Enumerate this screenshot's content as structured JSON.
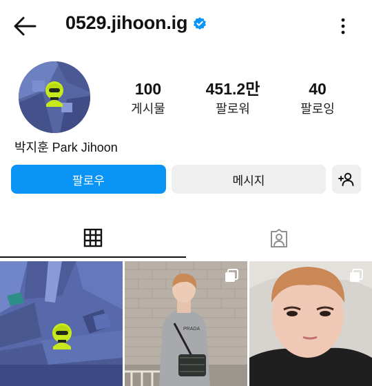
{
  "header": {
    "username": "0529.jihoon.ig",
    "back_icon": "arrow-left-icon",
    "verified_icon": "verified-badge-icon",
    "more_icon": "more-vertical-icon"
  },
  "profile": {
    "display_name": "박지훈 Park Jihoon",
    "stats": [
      {
        "value": "100",
        "label": "게시물"
      },
      {
        "value": "451.2만",
        "label": "팔로워"
      },
      {
        "value": "40",
        "label": "팔로잉"
      }
    ]
  },
  "actions": {
    "follow_label": "팔로우",
    "message_label": "메시지",
    "suggest_icon": "add-person-icon"
  },
  "tabs": {
    "posts_icon": "grid-icon",
    "tagged_icon": "tagged-person-icon"
  },
  "colors": {
    "accent": "#0a95f6",
    "verified": "#0a95f6",
    "secondary_button": "#efefef"
  },
  "posts": [
    {
      "type": "image",
      "icon": "none"
    },
    {
      "type": "carousel",
      "icon": "carousel-icon"
    },
    {
      "type": "carousel",
      "icon": "carousel-icon"
    }
  ]
}
